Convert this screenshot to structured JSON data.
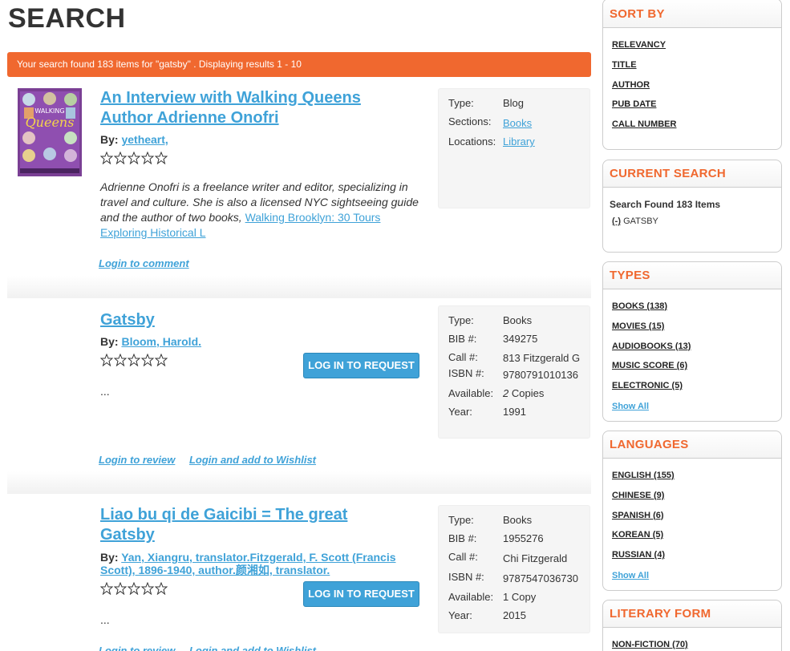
{
  "page": {
    "title": "SEARCH"
  },
  "summary": "Your search found 183 items for \"gatsby\" . Displaying results 1 - 10",
  "results": [
    {
      "title_line1": "An Interview with Walking Queens",
      "title_line2": "Author Adrienne Onofri",
      "by_label": "By:",
      "author": "yetheart,",
      "excerpt": "Adrienne Onofri is a freelance writer and editor, specializing in travel and culture. She is also a licensed NYC sightseeing guide and the author of two books,",
      "excerpt_link": "Walking Brooklyn: 30 Tours Exploring Historical L",
      "links": [
        "Login to comment"
      ],
      "rating": 0,
      "meta": [
        {
          "k": "Type:",
          "v": "Blog"
        },
        {
          "k": "Sections:",
          "v": "Books"
        },
        {
          "k": "Locations:",
          "v": "Library"
        }
      ],
      "cover": {
        "top_text": "WALKING",
        "main_text": "Queens",
        "color": "#6e3a8a"
      }
    },
    {
      "title_line1": "Gatsby",
      "by_label": "By:",
      "author": "Bloom, Harold.",
      "excerpt": "...",
      "request_button": "LOG IN TO REQUEST",
      "links": [
        "Login to review",
        "Login and add to Wishlist"
      ],
      "rating": 0,
      "meta": [
        {
          "k": "Type:",
          "v": "Books"
        },
        {
          "k": "BIB #:",
          "v": "349275"
        },
        {
          "k": "Call #:",
          "v": "813 Fitzgerald G"
        },
        {
          "k": "ISBN #:",
          "v": "9780791010136"
        },
        {
          "k": "Available:",
          "v": "2 Copies"
        },
        {
          "k": "Year:",
          "v": "1991"
        }
      ]
    },
    {
      "title_line1": "Liao bu qi de Gaicibi = The great",
      "title_line2": "Gatsby",
      "by_label": "By:",
      "author": "Yan, Xiangru, translator.Fitzgerald, F. Scott (Francis Scott), 1896-1940, author.颜湘如, translator.",
      "excerpt": "...",
      "request_button": "LOG IN TO REQUEST",
      "links": [
        "Login to review",
        "Login and add to Wishlist"
      ],
      "rating": 0,
      "meta": [
        {
          "k": "Type:",
          "v": "Books"
        },
        {
          "k": "BIB #:",
          "v": "1955276"
        },
        {
          "k": "Call #:",
          "v": "Chi Fitzgerald"
        },
        {
          "k": "ISBN #:",
          "v": "9787547036730"
        },
        {
          "k": "Available:",
          "v": "1 Copy"
        },
        {
          "k": "Year:",
          "v": "2015"
        }
      ]
    }
  ],
  "sidebar": {
    "sort": {
      "heading": "SORT BY",
      "items": [
        "RELEVANCY",
        "TITLE",
        "AUTHOR",
        "PUB DATE",
        "CALL NUMBER"
      ]
    },
    "current": {
      "heading": "CURRENT SEARCH",
      "found": "Search Found 183 Items",
      "remove": "(-)",
      "term": "GATSBY"
    },
    "types": {
      "heading": "TYPES",
      "items": [
        "BOOKS (138)",
        "MOVIES (15)",
        "AUDIOBOOKS (13)",
        "MUSIC SCORE (6)",
        "ELECTRONIC (5)"
      ],
      "show_all": "Show All"
    },
    "languages": {
      "heading": "LANGUAGES",
      "items": [
        "ENGLISH (155)",
        "CHINESE (9)",
        "SPANISH (6)",
        "KOREAN (5)",
        "RUSSIAN (4)"
      ],
      "show_all": "Show All"
    },
    "literary": {
      "heading": "LITERARY FORM",
      "items": [
        "NON-FICTION (70)"
      ]
    }
  },
  "colors": {
    "accent": "#f0682f",
    "link": "#3fa2d8"
  }
}
